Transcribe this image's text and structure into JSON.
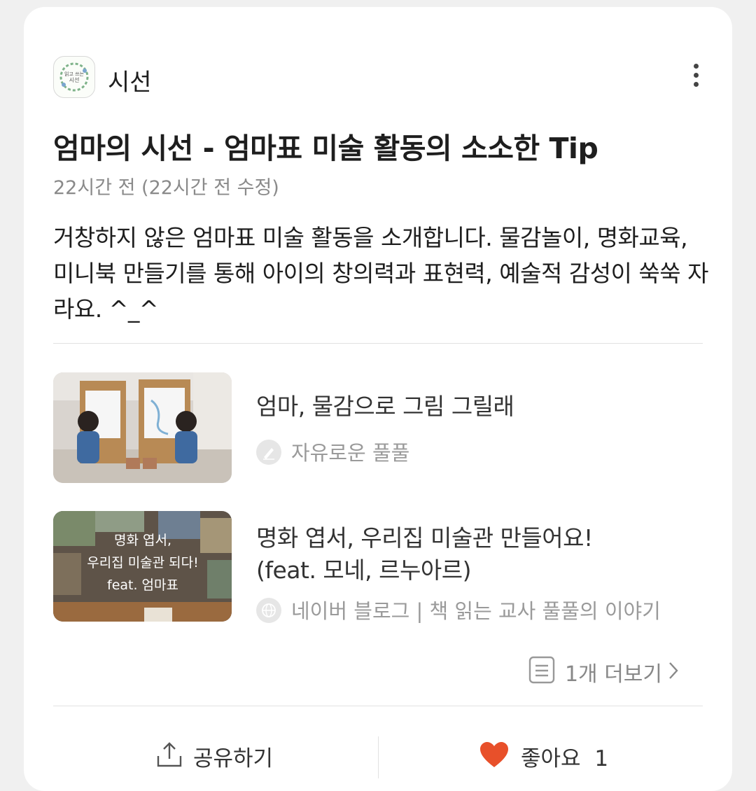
{
  "channel": {
    "name": "시선",
    "avatar_icon": "book-wreath-logo",
    "avatar_text": [
      "읽고 쓰는",
      "시선"
    ]
  },
  "post": {
    "title": "엄마의 시선 - 엄마표 미술 활동의 소소한 Tip",
    "timestamp": "22시간 전 (22시간 전 수정)",
    "description": "거창하지 않은 엄마표 미술 활동을 소개합니다. 물감놀이, 명화교육, 미니북 만들기를 통해 아이의 창의력과 표현력, 예술적 감성이 쑥쑥 자라요. ^_^"
  },
  "linked_posts": [
    {
      "title": "엄마, 물감으로 그림 그릴래",
      "source": "자유로운 풀풀",
      "source_icon": "pen-icon"
    },
    {
      "title_line1": "명화 엽서, 우리집 미술관 만들어요!",
      "title_line2": "(feat. 모네, 르누아르)",
      "source": "네이버 블로그 | 책 읽는 교사 풀풀의 이야기",
      "source_icon": "globe-icon",
      "thumb_text": [
        "명화 엽서,",
        "우리집 미술관 되다!",
        "feat. 엄마표"
      ]
    }
  ],
  "more": {
    "label": "1개 더보기"
  },
  "actions": {
    "share": "공유하기",
    "like": "좋아요",
    "like_count": "1"
  },
  "colors": {
    "like_heart": "#e8502a",
    "text": "#1e1e1e",
    "muted": "#8a8a8a"
  }
}
